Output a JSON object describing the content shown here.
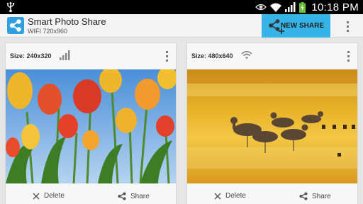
{
  "status_bar": {
    "time": "10:18 PM",
    "icons": [
      "usb-icon",
      "eye-icon",
      "wifi-icon",
      "signal-icon",
      "battery-icon"
    ]
  },
  "action_bar": {
    "app_icon": "share-icon",
    "title": "Smart Photo Share",
    "subtitle": "WIFI 720x960",
    "new_share_label": "NEW SHARE",
    "accent": "#36b4e7"
  },
  "cards": [
    {
      "size_label": "Size: 240x320",
      "network_icon": "signal-bars-icon",
      "photo": "tulips-photo",
      "delete_label": "Delete",
      "share_label": "Share"
    },
    {
      "size_label": "Size: 480x640",
      "network_icon": "wifi-icon",
      "photo": "ducks-photo",
      "delete_label": "Delete",
      "share_label": "Share"
    }
  ]
}
